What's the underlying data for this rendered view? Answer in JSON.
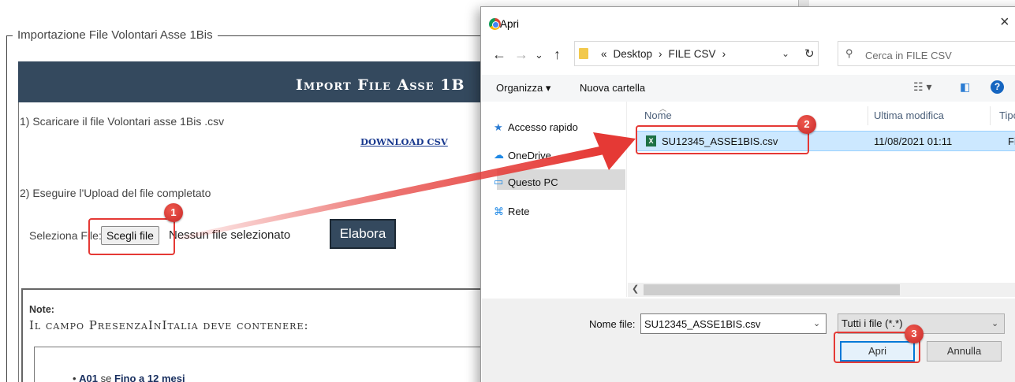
{
  "page": {
    "legend": "Importazione File Volontari Asse 1Bis",
    "banner_title": "Import File Asse 1B",
    "step1": "1) Scaricare il file Volontari asse 1Bis .csv",
    "download_link": "DOWNLOAD CSV",
    "step2": "2) Eseguire l'Upload del file completato",
    "file_label": "Seleziona File:",
    "choose_button": "Scegli file",
    "no_file_text": "Nessun file selezionato",
    "process_button": "Elabora",
    "note_label": "Note:",
    "note_subtitle": "Il campo PresenzaInItalia deve contenere:",
    "bullet_code": "A01",
    "bullet_mid": " se ",
    "bullet_value": "Fino a 12 mesi"
  },
  "dialog": {
    "title": "Apri",
    "close": "×",
    "nav_back": "←",
    "nav_forward": "→",
    "nav_recent": "⌄",
    "nav_up": "↑",
    "breadcrumb_lead": "«",
    "breadcrumb": [
      "Desktop",
      "FILE CSV"
    ],
    "breadcrumb_sep": "›",
    "refresh": "↻",
    "search_placeholder": "Cerca in FILE CSV",
    "toolbar": {
      "organize": "Organizza ▾",
      "new_folder": "Nuova cartella"
    },
    "nav_pane": [
      {
        "label": "Accesso rapido",
        "icon": "star-icon"
      },
      {
        "label": "OneDrive",
        "icon": "cloud-icon"
      },
      {
        "label": "Questo PC",
        "icon": "computer-icon"
      },
      {
        "label": "Rete",
        "icon": "network-icon"
      }
    ],
    "columns": {
      "name": "Nome",
      "modified": "Ultima modifica",
      "type": "Tipo"
    },
    "files": [
      {
        "name": "SU12345_ASSE1BIS.csv",
        "modified": "11/08/2021 01:11",
        "type": "File"
      }
    ],
    "filename_label": "Nome file:",
    "filename_value": "SU12345_ASSE1BIS.csv",
    "filetype_value": "Tutti i file (*.*)",
    "open_button": "Apri",
    "cancel_button": "Annulla"
  },
  "annotations": {
    "badge1": "1",
    "badge2": "2",
    "badge3": "3",
    "accent": "#e53935"
  }
}
